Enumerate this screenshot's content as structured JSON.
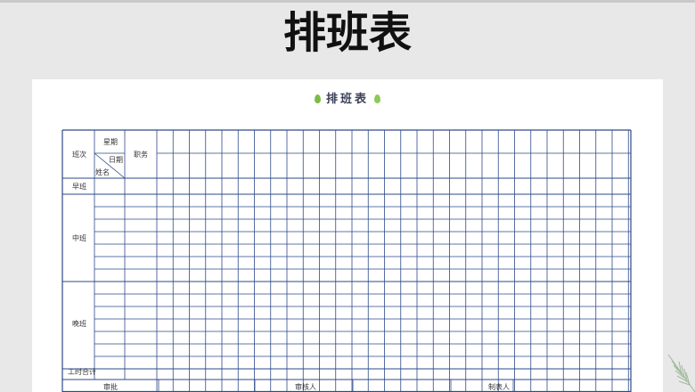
{
  "slide_title": "排班表",
  "sheet": {
    "title": "排班表",
    "header": {
      "shift_col": "班次",
      "weekday": "星期",
      "date": "日期",
      "name": "姓名",
      "position": "职务"
    },
    "rows": {
      "morning": "早班",
      "middle": "中班",
      "night": "晚班",
      "hours_total": "工时合计"
    },
    "footer": {
      "review": "审批",
      "reviewer": "审核人",
      "maker": "制表人"
    }
  }
}
